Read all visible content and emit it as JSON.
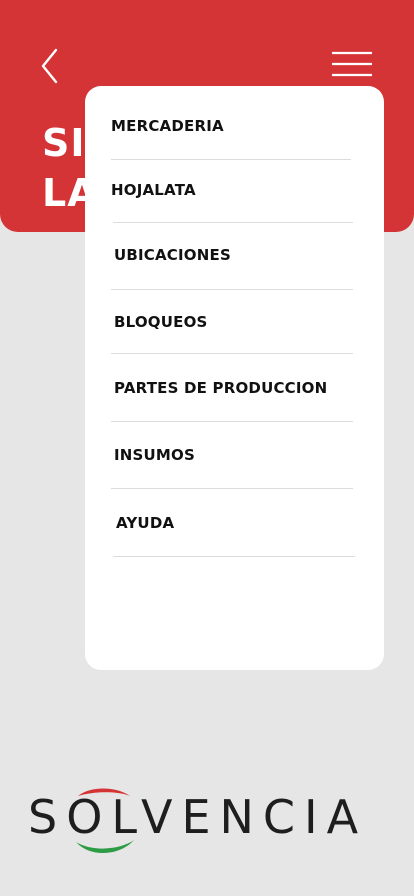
{
  "header": {
    "title_line1": "SIS",
    "title_line2": "LA",
    "back_icon": "chevron-left-icon",
    "menu_icon": "hamburger-menu-icon"
  },
  "menu": {
    "items": [
      {
        "label": "MERCADERIA"
      },
      {
        "label": "HOJALATA"
      },
      {
        "label": "UBICACIONES"
      },
      {
        "label": "BLOQUEOS"
      },
      {
        "label": "PARTES DE PRODUCCION"
      },
      {
        "label": "INSUMOS"
      },
      {
        "label": "AYUDA"
      }
    ]
  },
  "brand": {
    "logo_text": "SOLVENCIA",
    "colors": {
      "red": "#d43435",
      "green": "#2e9b45",
      "dark": "#1e1e1e"
    }
  }
}
